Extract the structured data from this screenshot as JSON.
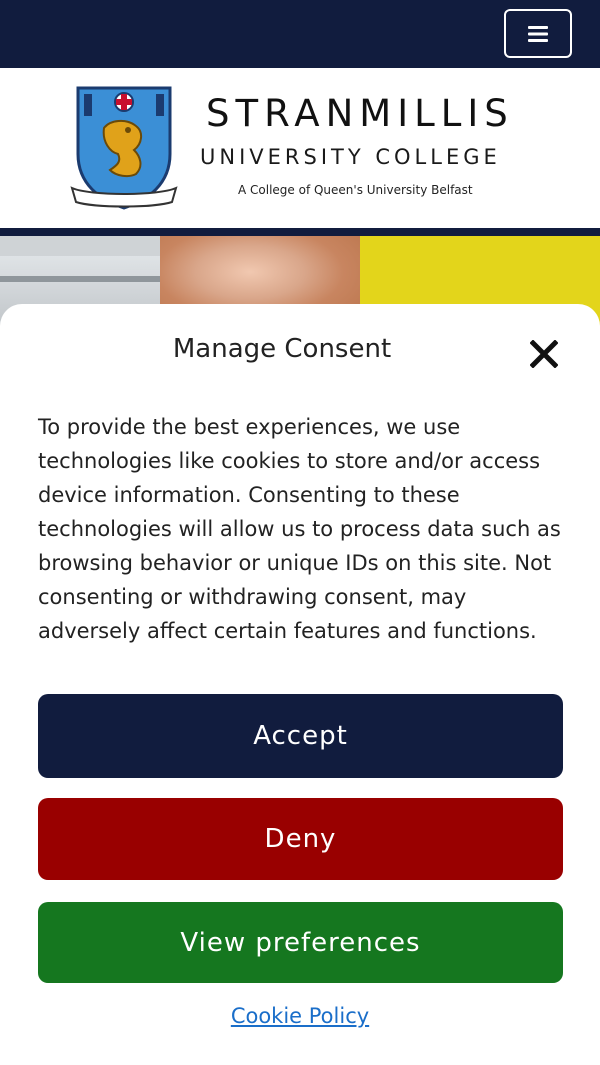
{
  "header": {
    "menu_icon": "hamburger-menu-icon",
    "background_color": "#111c3e"
  },
  "brand": {
    "name_line1": "STRANMILLIS",
    "name_line2": "UNIVERSITY COLLEGE",
    "tagline": "A College of Queen's University Belfast",
    "crest_icon": "college-crest-logo"
  },
  "hero": {
    "accent_color": "#e3d51b"
  },
  "consent": {
    "title": "Manage Consent",
    "close_icon": "close-icon",
    "body": "To provide the best experiences, we use technologies like cookies to store and/or access device information. Consenting to these technologies will allow us to process data such as browsing behavior or unique IDs on this site. Not consenting or withdrawing consent, may adversely affect certain features and functions.",
    "buttons": {
      "accept": "Accept",
      "deny": "Deny",
      "preferences": "View preferences"
    },
    "button_colors": {
      "accept": "#111c3e",
      "deny": "#990000",
      "preferences": "#15771f"
    },
    "policy_link": "Cookie Policy"
  }
}
